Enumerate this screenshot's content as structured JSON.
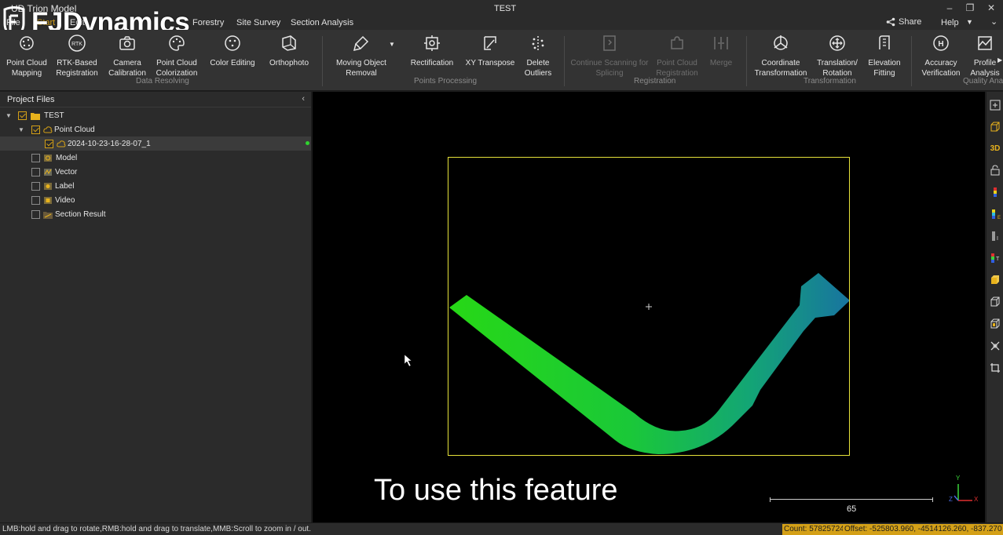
{
  "window": {
    "app_title": "UD Trion Model",
    "doc_title": "TEST",
    "logo_text": "FJDynamics"
  },
  "menu": {
    "items": [
      "File",
      "Start",
      "Edit",
      "Forestry",
      "Site Survey",
      "Section Analysis"
    ],
    "active": "Start",
    "share_label": "Share",
    "help_label": "Help"
  },
  "ribbon": {
    "tools": [
      {
        "label": "Point Cloud\nMapping",
        "icon": "point-cloud-mapping-icon"
      },
      {
        "label": "RTK-Based\nRegistration",
        "icon": "rtk-icon"
      },
      {
        "label": "Camera\nCalibration",
        "icon": "camera-icon"
      },
      {
        "label": "Point Cloud\nColorization",
        "icon": "palette-icon"
      },
      {
        "label": "Color Editing",
        "icon": "color-edit-icon"
      },
      {
        "label": "Orthophoto",
        "icon": "orthophoto-icon"
      },
      {
        "label": "Moving Object\nRemoval",
        "icon": "brush-icon"
      },
      {
        "label": "Rectification",
        "icon": "rectification-icon"
      },
      {
        "label": "XY Transpose",
        "icon": "transpose-icon"
      },
      {
        "label": "Delete\nOutliers",
        "icon": "delete-outliers-icon"
      },
      {
        "label": "Continue Scanning for\nSplicing",
        "icon": "splicing-icon",
        "disabled": true
      },
      {
        "label": "Point Cloud\nRegistration",
        "icon": "puzzle-icon",
        "disabled": true
      },
      {
        "label": "Merge",
        "icon": "merge-icon",
        "disabled": true
      },
      {
        "label": "Coordinate\nTransformation",
        "icon": "coordinate-icon"
      },
      {
        "label": "Translation/\nRotation",
        "icon": "move-icon"
      },
      {
        "label": "Elevation\nFitting",
        "icon": "elevation-icon"
      },
      {
        "label": "Accuracy\nVerification",
        "icon": "accuracy-icon"
      },
      {
        "label": "Profile\nAnalysis",
        "icon": "profile-icon"
      }
    ],
    "groups": [
      "Data Resolving",
      "Points Processing",
      "Registration",
      "Transformation",
      "Quality Ana"
    ]
  },
  "project_panel": {
    "title": "Project Files",
    "tree": [
      {
        "label": "TEST",
        "icon": "folder-icon",
        "checked": true
      },
      {
        "label": "Point Cloud",
        "icon": "cloud-icon",
        "checked": true
      },
      {
        "label": "2024-10-23-16-28-07_1",
        "icon": "cloud-icon",
        "checked": true,
        "status": "loaded"
      },
      {
        "label": "Model",
        "icon": "model-icon",
        "checked": false
      },
      {
        "label": "Vector",
        "icon": "vector-icon",
        "checked": false
      },
      {
        "label": "Label",
        "icon": "label-icon",
        "checked": false
      },
      {
        "label": "Video",
        "icon": "video-icon",
        "checked": false
      },
      {
        "label": "Section Result",
        "icon": "section-icon",
        "checked": false
      }
    ]
  },
  "viewport": {
    "caption": "To use this feature",
    "scale_value": "65",
    "axis_y": "Y",
    "axis_x": "X",
    "axis_z": "Z",
    "point_cloud_colors": [
      "#27d816",
      "#1ac838",
      "#13a575",
      "#1874a0"
    ],
    "bbox_color": "#e6e23a"
  },
  "right_toolbar": {
    "view_3d_label": "3D"
  },
  "status": {
    "hint": "LMB:hold and drag to rotate,RMB:hold and drag to translate,MMB:Scroll to zoom in / out.",
    "count": "Count: 57825724",
    "offset": "Offset: -525803.960, -4514126.260, -837.270",
    "accent": "#d4a017"
  }
}
